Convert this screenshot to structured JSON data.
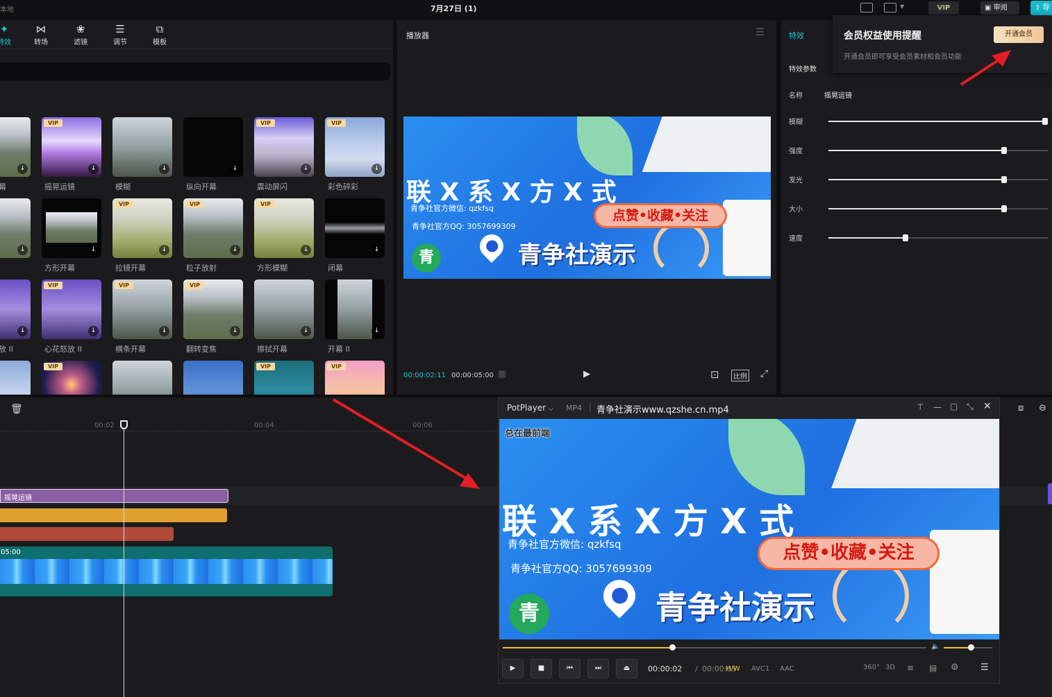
{
  "topbar": {
    "left_label": "本地",
    "title": "7月27日 (1)",
    "vip_label": "VIP",
    "review_label": "审阅",
    "export_label": "导"
  },
  "left_panel": {
    "tabs": [
      {
        "label": "特效",
        "icon": "sparkle-icon"
      },
      {
        "label": "转场",
        "icon": "transition-icon"
      },
      {
        "label": "滤镜",
        "icon": "filter-icon"
      },
      {
        "label": "调节",
        "icon": "adjust-icon"
      },
      {
        "label": "模板",
        "icon": "template-icon"
      }
    ],
    "vip_badge": "VIP",
    "row1": [
      "幕",
      "摇晃运镜",
      "模糊",
      "纵向开幕",
      "震动屏闪",
      "彩色碎彩"
    ],
    "row2": [
      "",
      "方形开幕",
      "拉镜开幕",
      "粒子放射",
      "方形模糊",
      "闭幕"
    ],
    "row3": [
      "放 II",
      "心花怒放 II",
      "横条开幕",
      "翻转变焦",
      "擦拭开幕",
      "开幕 II"
    ]
  },
  "player": {
    "title": "播放器",
    "time_current": "00:00:02:11",
    "time_total": "00:00:05:00",
    "ratio_label": "比例"
  },
  "video_content": {
    "headline": "联 X 系 X 方 X 式",
    "wechat": "青争社官方微信: qzkfsq",
    "qq": "青争社官方QQ: 3057699309",
    "badge": "点赞•收藏•关注",
    "brand": "青争社演示",
    "logo_char": "青"
  },
  "right_panel": {
    "tab": "特效",
    "section": "特效参数",
    "name_label": "名称",
    "name_value": "摇晃运镜",
    "params": [
      {
        "label": "模糊",
        "value": 1.0
      },
      {
        "label": "强度",
        "value": 0.8
      },
      {
        "label": "发光",
        "value": 0.8
      },
      {
        "label": "大小",
        "value": 0.8
      },
      {
        "label": "速度",
        "value": 0.35
      }
    ]
  },
  "vip_popup": {
    "title": "会员权益使用提醒",
    "desc": "开通会员即可享受会员素材和会员功能",
    "button": "开通会员"
  },
  "timeline": {
    "ticks": [
      "00:02",
      "00:04",
      "00:06"
    ],
    "effect_clip_label": "摇晃运镜",
    "video_clip_time": "05:00",
    "colors": {
      "effect": "#8a5ea3",
      "orange": "#e0a030",
      "red": "#b04a3a",
      "video": "#0f6e6e"
    }
  },
  "potplayer": {
    "app_name": "PotPlayer",
    "format": "MP4",
    "filename": "青争社演示www.qzshe.cn.mp4",
    "on_top": "总在最前端",
    "time_current": "00:00:02",
    "time_separator": "/",
    "time_total": "00:00:05",
    "tags": [
      "H/W",
      "AVC1",
      "AAC"
    ],
    "right_tags": [
      "360°",
      "3D"
    ],
    "seek_progress": 0.4,
    "volume": 0.55
  }
}
